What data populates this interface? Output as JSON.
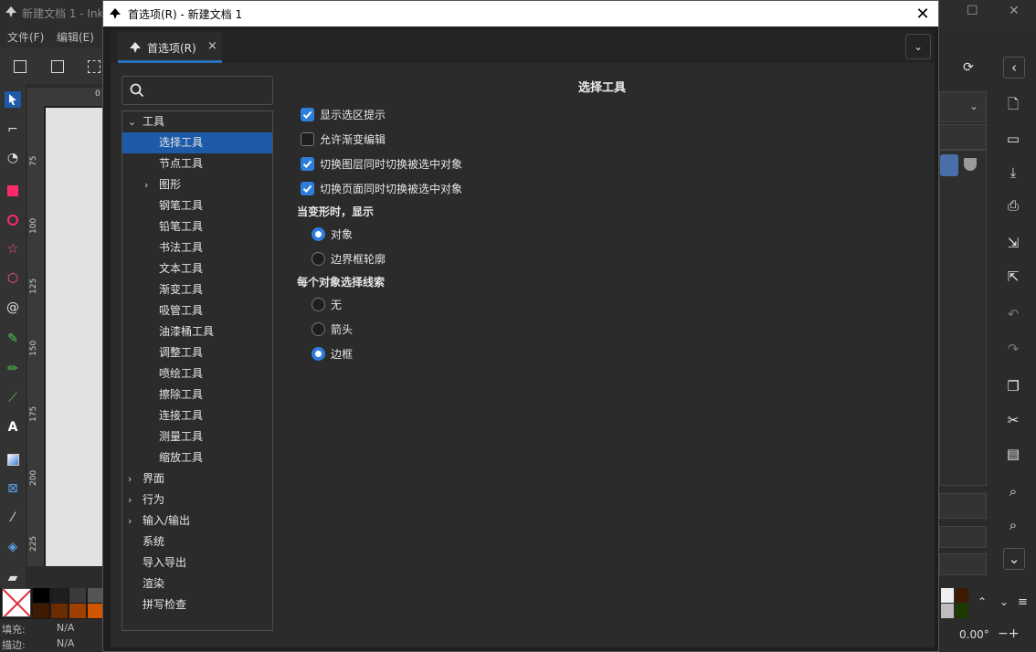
{
  "background_window": {
    "title": "新建文档 1 - Ink",
    "menu": [
      "文件(F)",
      "编辑(E)"
    ],
    "ruler_labels": [
      "75",
      "100",
      "125",
      "150",
      "175",
      "200",
      "225"
    ],
    "ruler_top_label": "0",
    "status": {
      "fill_label": "填充:",
      "fill_value": "N/A",
      "stroke_label": "描边:",
      "stroke_value": "N/A"
    },
    "rotation": "0.00°"
  },
  "dialog": {
    "title": "首选项(R) - 新建文档 1",
    "close_glyph": "✕",
    "tab": {
      "label": "首选项(R)",
      "close_glyph": "×"
    },
    "tab_dropdown_glyph": "⌄",
    "search": {
      "placeholder": ""
    },
    "tree": [
      {
        "label": "工具",
        "level": 0,
        "arrow": "⌄",
        "selected": false
      },
      {
        "label": "选择工具",
        "level": 1,
        "arrow": "",
        "selected": true
      },
      {
        "label": "节点工具",
        "level": 1,
        "arrow": "",
        "selected": false
      },
      {
        "label": "图形",
        "level": 1,
        "arrow": "›",
        "selected": false
      },
      {
        "label": "钢笔工具",
        "level": 1,
        "arrow": "",
        "selected": false
      },
      {
        "label": "铅笔工具",
        "level": 1,
        "arrow": "",
        "selected": false
      },
      {
        "label": "书法工具",
        "level": 1,
        "arrow": "",
        "selected": false
      },
      {
        "label": "文本工具",
        "level": 1,
        "arrow": "",
        "selected": false
      },
      {
        "label": "渐变工具",
        "level": 1,
        "arrow": "",
        "selected": false
      },
      {
        "label": "吸管工具",
        "level": 1,
        "arrow": "",
        "selected": false
      },
      {
        "label": "油漆桶工具",
        "level": 1,
        "arrow": "",
        "selected": false
      },
      {
        "label": "调整工具",
        "level": 1,
        "arrow": "",
        "selected": false
      },
      {
        "label": "喷绘工具",
        "level": 1,
        "arrow": "",
        "selected": false
      },
      {
        "label": "擦除工具",
        "level": 1,
        "arrow": "",
        "selected": false
      },
      {
        "label": "连接工具",
        "level": 1,
        "arrow": "",
        "selected": false
      },
      {
        "label": "测量工具",
        "level": 1,
        "arrow": "",
        "selected": false
      },
      {
        "label": "缩放工具",
        "level": 1,
        "arrow": "",
        "selected": false
      },
      {
        "label": "界面",
        "level": 0,
        "arrow": "›",
        "selected": false
      },
      {
        "label": "行为",
        "level": 0,
        "arrow": "›",
        "selected": false
      },
      {
        "label": "输入/输出",
        "level": 0,
        "arrow": "›",
        "selected": false
      },
      {
        "label": "系统",
        "level": 0,
        "arrow": "",
        "selected": false
      },
      {
        "label": "导入导出",
        "level": 0,
        "arrow": "",
        "selected": false
      },
      {
        "label": "渲染",
        "level": 0,
        "arrow": "",
        "selected": false
      },
      {
        "label": "拼写检查",
        "level": 0,
        "arrow": "",
        "selected": false
      }
    ],
    "panel": {
      "title": "选择工具",
      "checkboxes": [
        {
          "label": "显示选区提示",
          "checked": true
        },
        {
          "label": "允许渐变编辑",
          "checked": false
        },
        {
          "label": "切换图层同时切换被选中对象",
          "checked": true
        },
        {
          "label": "切换页面同时切换被选中对象",
          "checked": true
        }
      ],
      "transform_section": {
        "label": "当变形时，显示",
        "options": [
          {
            "label": "对象",
            "selected": true
          },
          {
            "label": "边界框轮廓",
            "selected": false
          }
        ]
      },
      "cue_section": {
        "label": "每个对象选择线索",
        "options": [
          {
            "label": "无",
            "selected": false
          },
          {
            "label": "箭头",
            "selected": false
          },
          {
            "label": "边框",
            "selected": true
          }
        ]
      }
    }
  },
  "colors": {
    "accent": "#2f7ddc",
    "selection": "#1d5aa8"
  }
}
